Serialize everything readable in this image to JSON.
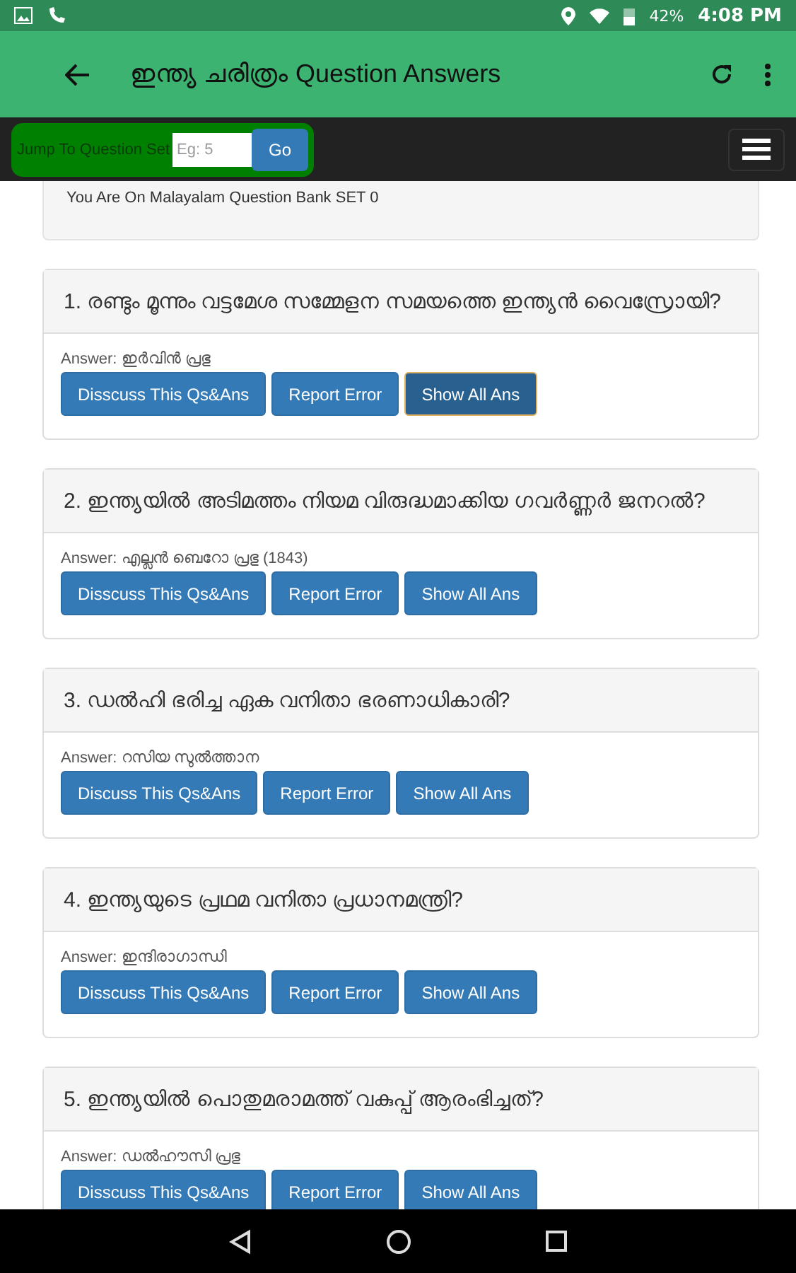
{
  "status_bar": {
    "battery": "42%",
    "time": "4:08 PM"
  },
  "app_bar": {
    "title": "ഇന്ത്യ ചരിത്രം Question Answers"
  },
  "jump": {
    "label": "Jump To Question Set",
    "placeholder": "Eg: 5",
    "button": "Go"
  },
  "info": "You Are On Malayalam Question Bank SET 0",
  "questions": [
    {
      "question": "1. രണ്ടും മൂന്നും വട്ടമേശ സമ്മേളന സമയത്തെ ഇന്ത്യൻ വൈസ്രോയി?",
      "answer": "Answer: ഇർവിൻ പ്രഭു",
      "buttons": [
        {
          "label": "Disscuss This Qs&Ans",
          "focused": false
        },
        {
          "label": "Report Error",
          "focused": false
        },
        {
          "label": "Show All Ans",
          "focused": true
        }
      ]
    },
    {
      "question": "2. ഇന്ത്യയിൽ അടിമത്തം നിയമ വിരുദ്ധമാക്കിയ ഗവർണ്ണർ ജനറൽ?",
      "answer": "Answer: എല്ലൻ ബെറോ പ്രഭു (1843)",
      "buttons": [
        {
          "label": "Disscuss This Qs&Ans",
          "focused": false
        },
        {
          "label": "Report Error",
          "focused": false
        },
        {
          "label": "Show All Ans",
          "focused": false
        }
      ]
    },
    {
      "question": "3. ഡൽഹി ഭരിച്ച ഏക വനിതാ ഭരണാധികാരി?",
      "answer": "Answer: റസിയ സുൽത്താന",
      "buttons": [
        {
          "label": "Discuss This Qs&Ans",
          "focused": false
        },
        {
          "label": "Report Error",
          "focused": false
        },
        {
          "label": "Show All Ans",
          "focused": false
        }
      ]
    },
    {
      "question": "4. ഇന്ത്യയുടെ പ്രഥമ വനിതാ പ്രധാനമന്ത്രി?",
      "answer": "Answer: ഇന്ദിരാഗാന്ധി",
      "buttons": [
        {
          "label": "Disscuss This Qs&Ans",
          "focused": false
        },
        {
          "label": "Report Error",
          "focused": false
        },
        {
          "label": "Show All Ans",
          "focused": false
        }
      ]
    },
    {
      "question": "5. ഇന്ത്യയിൽ പൊതുമരാമത്ത് വകുപ്പ് ആരംഭിച്ചത്?",
      "answer": "Answer: ഡൽഹൗസി പ്രഭു",
      "buttons": [
        {
          "label": "Disscuss This Qs&Ans",
          "focused": false
        },
        {
          "label": "Report Error",
          "focused": false
        },
        {
          "label": "Show All Ans",
          "focused": false
        }
      ]
    }
  ]
}
